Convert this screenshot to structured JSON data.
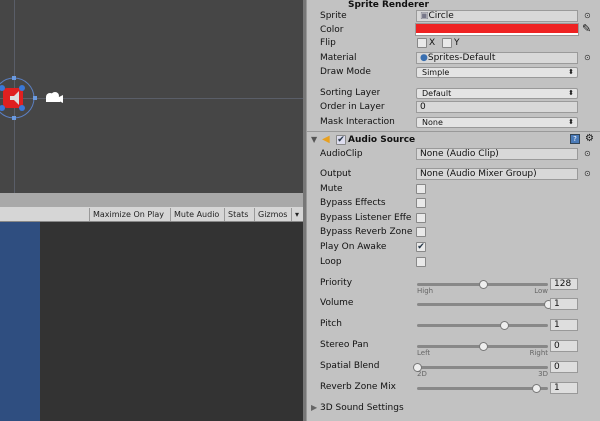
{
  "scene": {
    "gameview_toolbar": [
      "Maximize On Play",
      "Mute Audio",
      "Stats",
      "Gizmos"
    ]
  },
  "sprite_renderer": {
    "title": "Sprite Renderer",
    "rows": {
      "sprite_label": "Sprite",
      "sprite_value": "Circle",
      "color_label": "Color",
      "color_value": "#ee2222",
      "flip_label": "Flip",
      "flip_x": "X",
      "flip_y": "Y",
      "material_label": "Material",
      "material_value": "Sprites-Default",
      "draw_mode_label": "Draw Mode",
      "draw_mode_value": "Simple",
      "sorting_layer_label": "Sorting Layer",
      "sorting_layer_value": "Default",
      "order_label": "Order in Layer",
      "order_value": "0",
      "mask_label": "Mask Interaction",
      "mask_value": "None"
    }
  },
  "audio_source": {
    "title": "Audio Source",
    "audioclip_label": "AudioClip",
    "audioclip_value": "None (Audio Clip)",
    "output_label": "Output",
    "output_value": "None (Audio Mixer Group)",
    "toggles": [
      {
        "label": "Mute",
        "checked": false
      },
      {
        "label": "Bypass Effects",
        "checked": false
      },
      {
        "label": "Bypass Listener Effe",
        "checked": false
      },
      {
        "label": "Bypass Reverb Zone",
        "checked": false
      },
      {
        "label": "Play On Awake",
        "checked": true
      },
      {
        "label": "Loop",
        "checked": false
      }
    ],
    "sliders": [
      {
        "label": "Priority",
        "value": "128",
        "fraction": 0.5,
        "min_label": "High",
        "max_label": "Low"
      },
      {
        "label": "Volume",
        "value": "1",
        "fraction": 1.0
      },
      {
        "label": "Pitch",
        "value": "1",
        "fraction": 0.667
      },
      {
        "label": "Stereo Pan",
        "value": "0",
        "fraction": 0.5,
        "min_label": "Left",
        "max_label": "Right"
      },
      {
        "label": "Spatial Blend",
        "value": "0",
        "fraction": 0.0,
        "min_label": "2D",
        "max_label": "3D"
      },
      {
        "label": "Reverb Zone Mix",
        "value": "1",
        "fraction": 0.909
      }
    ],
    "sound_settings_label": "3D Sound Settings"
  }
}
